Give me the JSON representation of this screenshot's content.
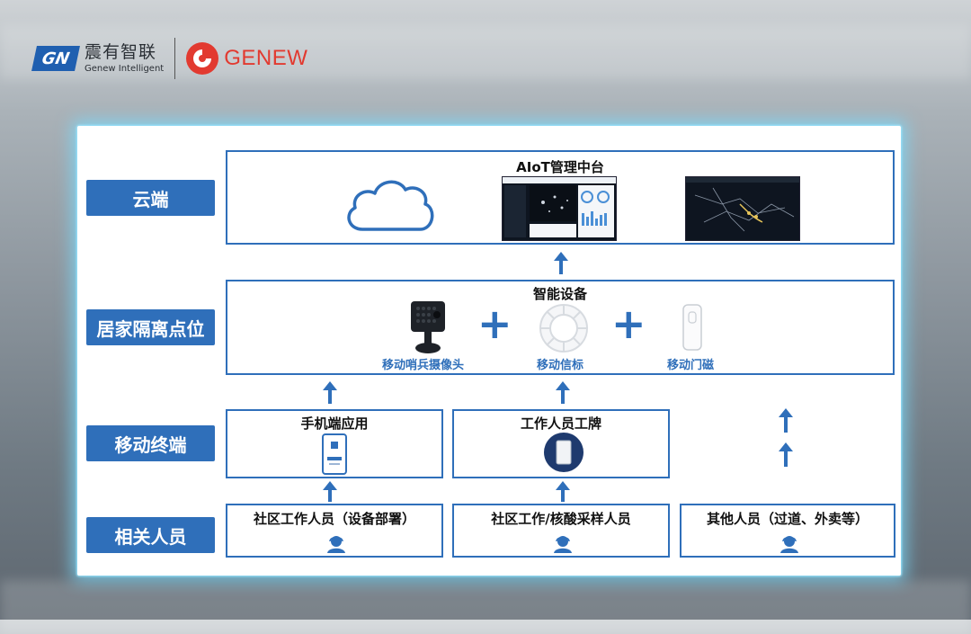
{
  "brand": {
    "mark": "GN",
    "name_cn": "震有智联",
    "name_en": "Genew Intelligent",
    "genew": "GENEW"
  },
  "colors": {
    "accent": "#2f6fba",
    "brand_red": "#e23a30",
    "glow": "#7fdcff"
  },
  "tiers": [
    "云端",
    "居家隔离点位",
    "移动终端",
    "相关人员"
  ],
  "cloud": {
    "title": "AIoT管理中台",
    "icon": "cloud-icon"
  },
  "devices": {
    "title": "智能设备",
    "items": [
      {
        "label": "移动哨兵摄像头",
        "icon": "camera-icon"
      },
      {
        "label": "移动信标",
        "icon": "beacon-icon"
      },
      {
        "label": "移动门磁",
        "icon": "door-sensor-icon"
      }
    ],
    "plus": "+"
  },
  "terminals": [
    {
      "title": "手机端应用",
      "icon": "phone-icon"
    },
    {
      "title": "工作人员工牌",
      "icon": "badge-icon"
    }
  ],
  "people": [
    {
      "title": "社区工作人员（设备部署）",
      "icon": "person-icon"
    },
    {
      "title": "社区工作/核酸采样人员",
      "icon": "person-icon"
    },
    {
      "title": "其他人员（过道、外卖等）",
      "icon": "person-icon"
    }
  ]
}
